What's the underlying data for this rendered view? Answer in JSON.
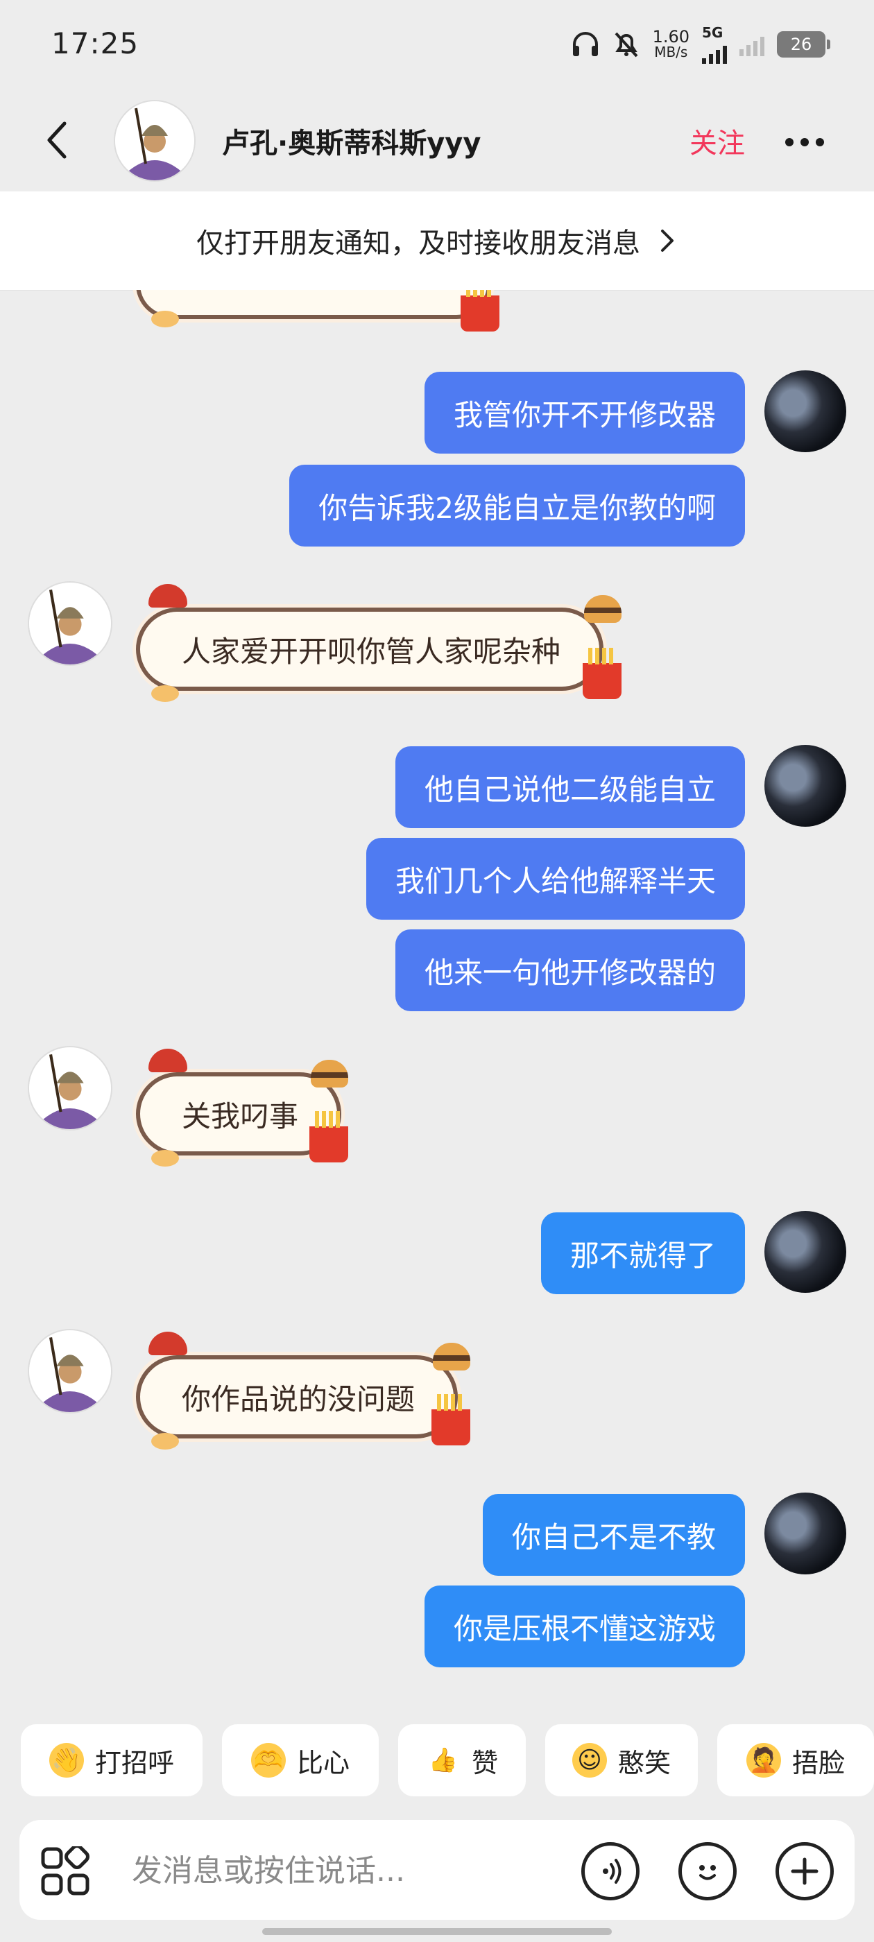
{
  "status_bar": {
    "time": "17:25",
    "net_speed_value": "1.60",
    "net_speed_unit": "MB/s",
    "network_type": "5G",
    "battery_level": "26"
  },
  "header": {
    "contact_name": "卢孔·奥斯蒂科斯yyy",
    "follow_label": "关注"
  },
  "notice": {
    "text": "仅打开朋友通知，及时接收朋友消息"
  },
  "messages": [
    {
      "side": "out",
      "text": "我管你开不开修改器"
    },
    {
      "side": "out",
      "text": "你告诉我2级能自立是你教的啊"
    },
    {
      "side": "in",
      "text": "人家爱开开呗你管人家呢杂种"
    },
    {
      "side": "out",
      "text": "他自己说他二级能自立"
    },
    {
      "side": "out",
      "text": "我们几个人给他解释半天"
    },
    {
      "side": "out",
      "text": "他来一句他开修改器的"
    },
    {
      "side": "in",
      "text": "关我叼事"
    },
    {
      "side": "out",
      "text": "那不就得了"
    },
    {
      "side": "in",
      "text": "你作品说的没问题"
    },
    {
      "side": "out",
      "text": "你自己不是不教"
    },
    {
      "side": "out",
      "text": "你是压根不懂这游戏"
    }
  ],
  "quick_replies": [
    {
      "icon": "waving-emoji-icon",
      "label": "打招呼"
    },
    {
      "icon": "heart-hands-emoji-icon",
      "label": "比心"
    },
    {
      "icon": "thumbs-up-emoji-icon",
      "label": "赞"
    },
    {
      "icon": "shy-smile-emoji-icon",
      "label": "憨笑"
    },
    {
      "icon": "facepalm-emoji-icon",
      "label": "捂脸"
    }
  ],
  "input": {
    "placeholder": "发消息或按住说话..."
  },
  "colors": {
    "outgoing_bubble": "#4f7bf2",
    "outgoing_bubble_light": "#2f8df7",
    "follow_accent": "#f2375b",
    "background": "#ededed"
  }
}
